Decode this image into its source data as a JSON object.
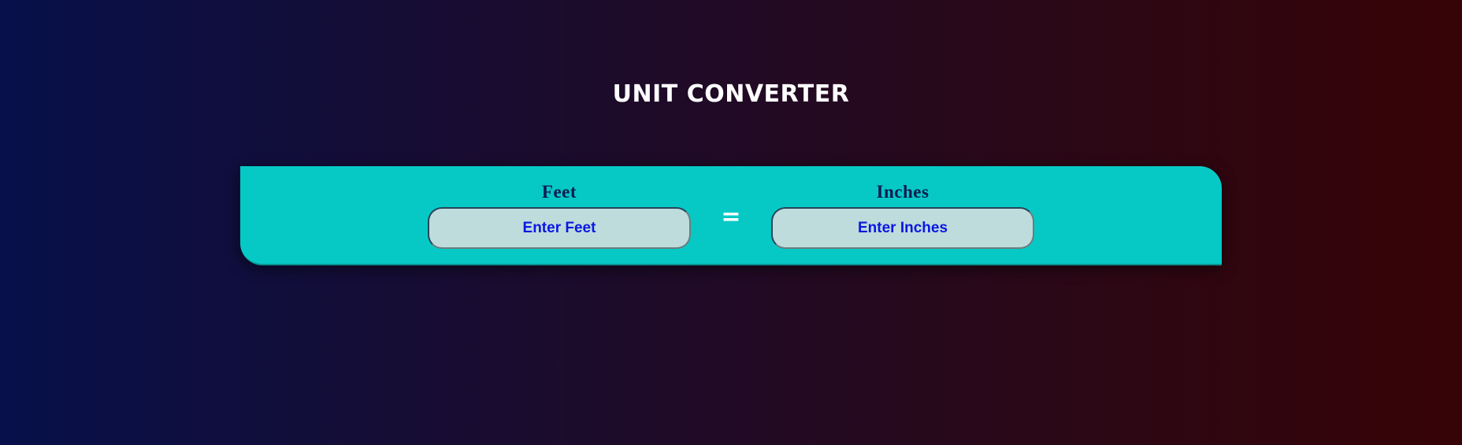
{
  "page": {
    "title": "UNIT CONVERTER"
  },
  "converter": {
    "from": {
      "label": "Feet",
      "placeholder": "Enter Feet",
      "value": ""
    },
    "operator": "=",
    "to": {
      "label": "Inches",
      "placeholder": "Enter Inches",
      "value": ""
    }
  },
  "colors": {
    "background_start": "#07104a",
    "background_end": "#360306",
    "panel": "#06c9c6",
    "input_background": "#bddcdb",
    "input_text": "#0b18e0",
    "label_text": "#0d1b4f"
  }
}
